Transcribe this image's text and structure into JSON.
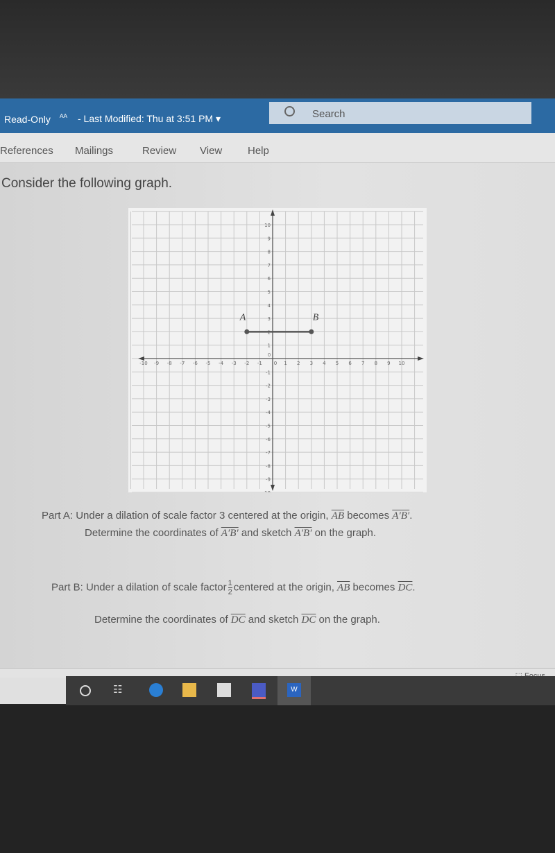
{
  "titlebar": {
    "read_only": "Read-Only",
    "last_modified": "- Last Modified: Thu at 3:51 PM",
    "search_placeholder": "Search"
  },
  "ribbon": {
    "tabs": [
      "References",
      "Mailings",
      "Review",
      "View",
      "Help"
    ]
  },
  "document": {
    "intro": "Consider the following graph.",
    "part_a": {
      "prefix": "Part A: Under a dilation of scale factor 3 centered at the origin,",
      "seg": "AB",
      "mid": "becomes",
      "seg2": "A′B′",
      "end": ".",
      "line2_prefix": "Determine the coordinates of",
      "line2_mid": "and sketch",
      "line2_end": "on the graph."
    },
    "part_b": {
      "prefix": "Part B: Under a dilation of scale factor",
      "num": "1",
      "den": "2",
      "mid1": "centered at the origin,",
      "seg": "AB",
      "mid": "becomes",
      "seg2": "DC",
      "end": ".",
      "line2_prefix": "Determine the coordinates of",
      "line2_mid": "and sketch",
      "line2_end": "on the graph."
    }
  },
  "chart_data": {
    "type": "scatter",
    "xlim": [
      -10,
      10
    ],
    "ylim": [
      -10,
      10
    ],
    "grid": true,
    "x_ticks": [
      -10,
      -9,
      -8,
      -7,
      -6,
      -5,
      -4,
      -3,
      -2,
      -1,
      0,
      1,
      2,
      3,
      4,
      5,
      6,
      7,
      8,
      9,
      10
    ],
    "y_ticks": [
      -10,
      -9,
      -8,
      -7,
      -6,
      -5,
      -4,
      -3,
      -2,
      -1,
      0,
      1,
      2,
      3,
      4,
      5,
      6,
      7,
      8,
      9,
      10
    ],
    "points": [
      {
        "label": "A",
        "x": -2,
        "y": 2
      },
      {
        "label": "B",
        "x": 3,
        "y": 2
      }
    ],
    "segments": [
      {
        "from": "A",
        "to": "B"
      }
    ]
  },
  "status": {
    "focus": "Focus"
  },
  "taskbar": {
    "icons": [
      "cortana-icon",
      "task-view-icon",
      "edge-icon",
      "file-explorer-icon",
      "store-icon",
      "teams-icon",
      "word-icon"
    ],
    "word_label": "W"
  },
  "colors": {
    "titlebar": "#2c6aa3",
    "segment": "#555555"
  }
}
